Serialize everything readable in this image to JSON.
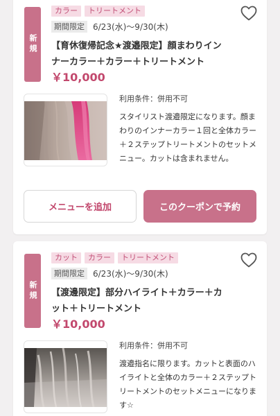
{
  "coupons": [
    {
      "badge": "新規",
      "tags": [
        "カラー",
        "トリートメント"
      ],
      "period_label": "期間限定",
      "period_value": "6/23(水)～9/30(木)",
      "title": "【育休復帰記念★渡邉限定】顔まわりインナーカラー＋カラー＋トリートメント",
      "price": "￥10,000",
      "terms": "利用条件：併用不可",
      "description": "スタイリスト渡邉限定になります。顔まわりのインナーカラー１回と全体カラー＋２ステップトリートメントのセットメニュー。カットは含まれません。",
      "add_menu_label": "メニューを追加",
      "reserve_label": "このクーポンで予約"
    },
    {
      "badge": "新規",
      "tags": [
        "カット",
        "カラー",
        "トリートメント"
      ],
      "period_label": "期間限定",
      "period_value": "6/23(水)～9/30(木)",
      "title": "【渡邊限定】部分ハイライト＋カラー＋カット＋トリートメント",
      "price": "￥10,000",
      "terms": "利用条件：併用不可",
      "description": "渡邉指名に限ります。カットと表面のハイライトと全体のカラー＋２ステップトリートメントのセットメニューになります☆"
    }
  ],
  "colors": {
    "accent": "#c8718a",
    "price": "#c2486d",
    "tag_bg": "#f6dbe4",
    "tag_text": "#c25077"
  },
  "icons": {
    "favorite": "heart-outline-icon"
  }
}
